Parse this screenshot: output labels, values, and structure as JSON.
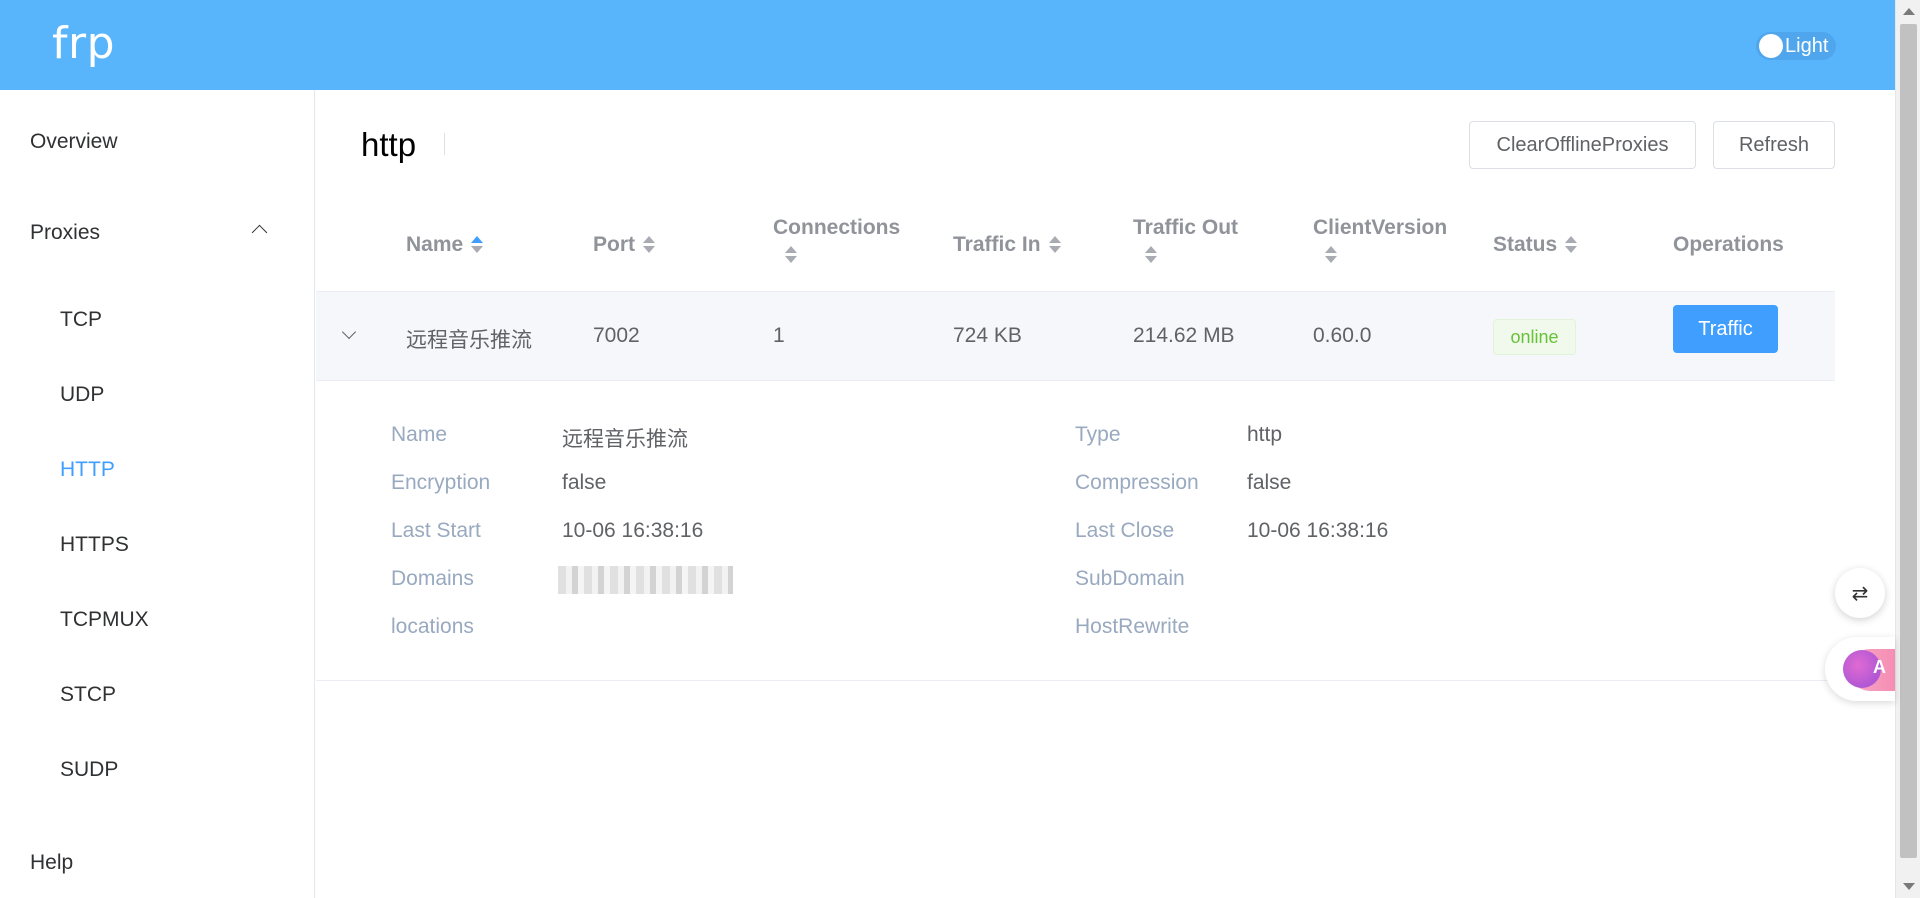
{
  "header": {
    "logo": "frp",
    "theme_label": "Light"
  },
  "sidebar": {
    "overview": "Overview",
    "proxies": "Proxies",
    "sub_items": [
      "TCP",
      "UDP",
      "HTTP",
      "HTTPS",
      "TCPMUX",
      "STCP",
      "SUDP"
    ],
    "active_item": "HTTP",
    "help": "Help"
  },
  "main": {
    "title": "http",
    "clear_button": "ClearOfflineProxies",
    "refresh_button": "Refresh"
  },
  "table": {
    "columns": [
      "Name",
      "Port",
      "Connections",
      "Traffic In",
      "Traffic Out",
      "ClientVersion",
      "Status",
      "Operations"
    ],
    "rows": [
      {
        "name": "远程音乐推流",
        "port": "7002",
        "connections": "1",
        "traffic_in": "724 KB",
        "traffic_out": "214.62 MB",
        "client_version": "0.60.0",
        "status": "online",
        "operation": "Traffic"
      }
    ]
  },
  "detail": {
    "name_label": "Name",
    "name_value": "远程音乐推流",
    "type_label": "Type",
    "type_value": "http",
    "encryption_label": "Encryption",
    "encryption_value": "false",
    "compression_label": "Compression",
    "compression_value": "false",
    "last_start_label": "Last Start",
    "last_start_value": "10-06 16:38:16",
    "last_close_label": "Last Close",
    "last_close_value": "10-06 16:38:16",
    "domains_label": "Domains",
    "subdomain_label": "SubDomain",
    "locations_label": "locations",
    "hostrewrite_label": "HostRewrite"
  },
  "widgets": {
    "translate_icon": "translate-icon",
    "ai_icon": "ai-brain-icon",
    "ai_text": "A"
  },
  "colors": {
    "header": "#58b4fb",
    "accent": "#409eff",
    "online": "#67c23a"
  }
}
